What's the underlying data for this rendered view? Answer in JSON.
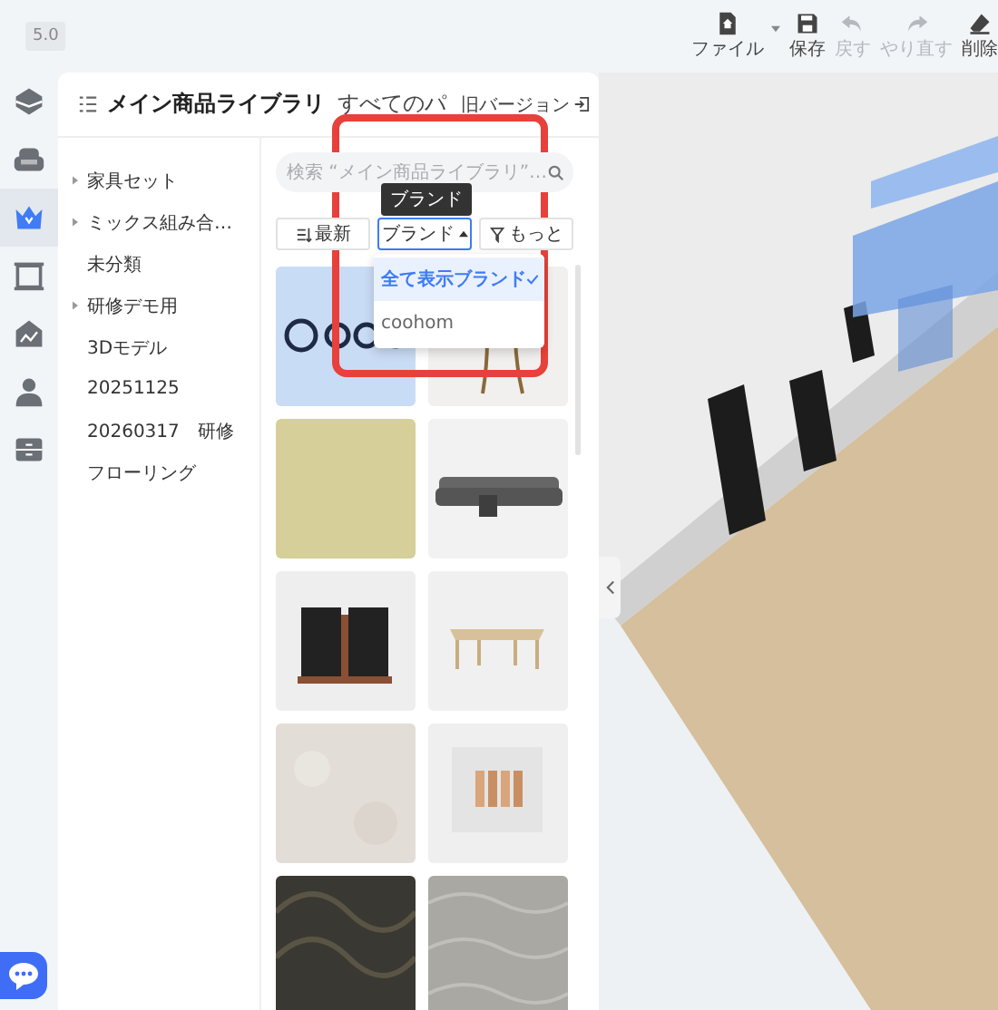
{
  "toolbar": {
    "version": "5.0",
    "buttons": [
      {
        "label": "ファイル",
        "kind": "file",
        "disabled": false
      },
      {
        "label": "保存",
        "kind": "save",
        "disabled": false
      },
      {
        "label": "戻す",
        "kind": "undo",
        "disabled": true
      },
      {
        "label": "やり直す",
        "kind": "redo",
        "disabled": true
      },
      {
        "label": "削除",
        "kind": "erase",
        "disabled": false
      }
    ]
  },
  "rail": [
    {
      "kind": "cube",
      "selected": false
    },
    {
      "kind": "sofa",
      "selected": false
    },
    {
      "kind": "crown",
      "selected": true
    },
    {
      "kind": "door",
      "selected": false
    },
    {
      "kind": "house",
      "selected": false
    },
    {
      "kind": "person",
      "selected": false
    },
    {
      "kind": "cabinet",
      "selected": false
    }
  ],
  "panel": {
    "title": "メイン商品ライブラリ",
    "scope": "すべてのパ",
    "old_version": "旧バージョン"
  },
  "categories": [
    {
      "label": "家具セット",
      "expanded": false
    },
    {
      "label": "ミックス組み合…",
      "expanded": false
    },
    {
      "label": "未分類"
    },
    {
      "label": "研修デモ用",
      "expanded": false
    },
    {
      "label": "3Dモデル"
    },
    {
      "label": "20251125"
    },
    {
      "label": "20260317　研修"
    },
    {
      "label": "フローリング"
    }
  ],
  "search": {
    "placeholder": "検索 “メイン商品ライブラリ”…"
  },
  "filters": [
    {
      "label": "最新",
      "kind": "sort",
      "open": false
    },
    {
      "label": "ブランド",
      "kind": "dropdown",
      "open": true
    },
    {
      "label": "もっと",
      "kind": "filter",
      "open": false
    }
  ],
  "tooltip": "ブランド",
  "brand_menu": [
    {
      "label": "全て表示ブランド",
      "selected": true
    },
    {
      "label": "coohom",
      "selected": false
    }
  ]
}
